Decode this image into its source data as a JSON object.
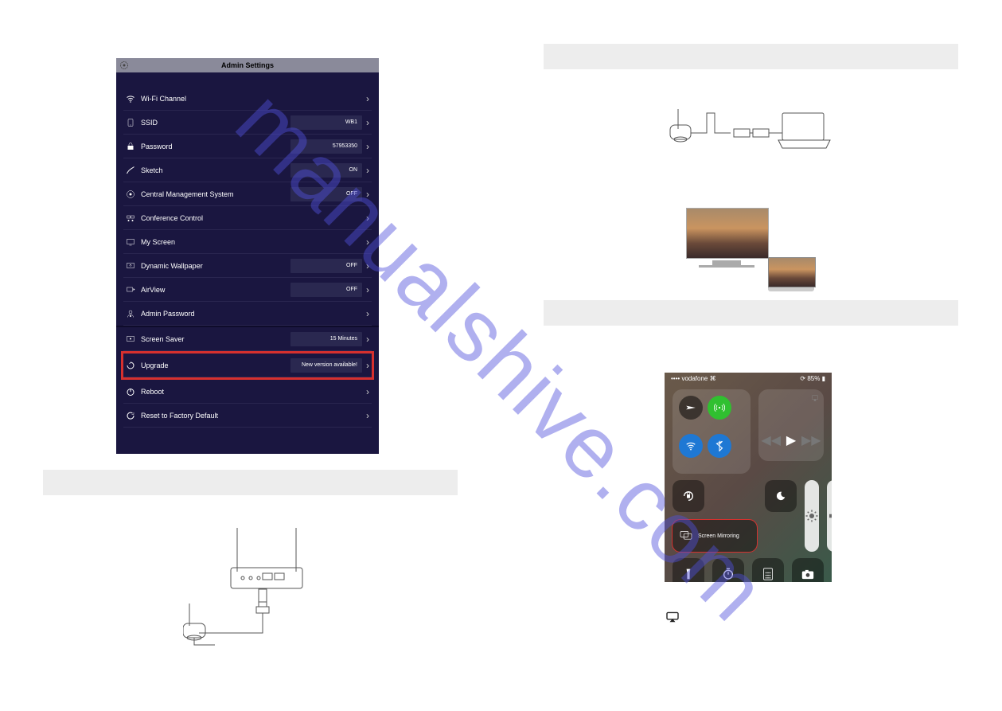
{
  "watermark": "manualshive.com",
  "admin": {
    "title": "Admin Settings",
    "rows": [
      {
        "icon": "wifi",
        "label": "Wi-Fi Channel",
        "value": null
      },
      {
        "icon": "ssid",
        "label": "SSID",
        "value": "WB1"
      },
      {
        "icon": "lock",
        "label": "Password",
        "value": "57953350"
      },
      {
        "icon": "sketch",
        "label": "Sketch",
        "value": "ON"
      },
      {
        "icon": "cms",
        "label": "Central Management System",
        "value": "OFF"
      },
      {
        "icon": "conf",
        "label": "Conference Control",
        "value": null
      },
      {
        "icon": "screen",
        "label": "My Screen",
        "value": null
      },
      {
        "icon": "wallpaper",
        "label": "Dynamic Wallpaper",
        "value": "OFF"
      },
      {
        "icon": "airview",
        "label": "AirView",
        "value": "OFF"
      },
      {
        "icon": "adminpw",
        "label": "Admin Password",
        "value": null
      },
      {
        "icon": "saver",
        "label": "Screen Saver",
        "value": "15 Minutes"
      },
      {
        "icon": "upgrade",
        "label": "Upgrade",
        "value": "New version available!",
        "highlight": true
      },
      {
        "icon": "reboot",
        "label": "Reboot",
        "value": null
      },
      {
        "icon": "reset",
        "label": "Reset to Factory Default",
        "value": null
      }
    ]
  },
  "ios": {
    "carrier": "vodafone",
    "batteryText": "85%",
    "wifiGlyph": "wifi-icon",
    "batteryGlyph": "battery-icon",
    "signalGlyph": "signal-icon",
    "screenMirroring": "Screen Mirroring",
    "toggles": {
      "airplane": "airplane-icon",
      "cellular": "antenna-icon",
      "wifi": "wifi-icon",
      "bluetooth": "bluetooth-icon"
    },
    "media": {
      "prev": "prev-icon",
      "play": "play-icon",
      "next": "next-icon",
      "airplay": "airplay-icon"
    },
    "small": {
      "lock": "rotation-lock-icon",
      "dnd": "moon-icon",
      "brightness": "sun-icon",
      "volume": "speaker-icon"
    },
    "bottom": {
      "flash": "flashlight-icon",
      "timer": "timer-icon",
      "calc": "calculator-icon",
      "camera": "camera-icon"
    }
  }
}
